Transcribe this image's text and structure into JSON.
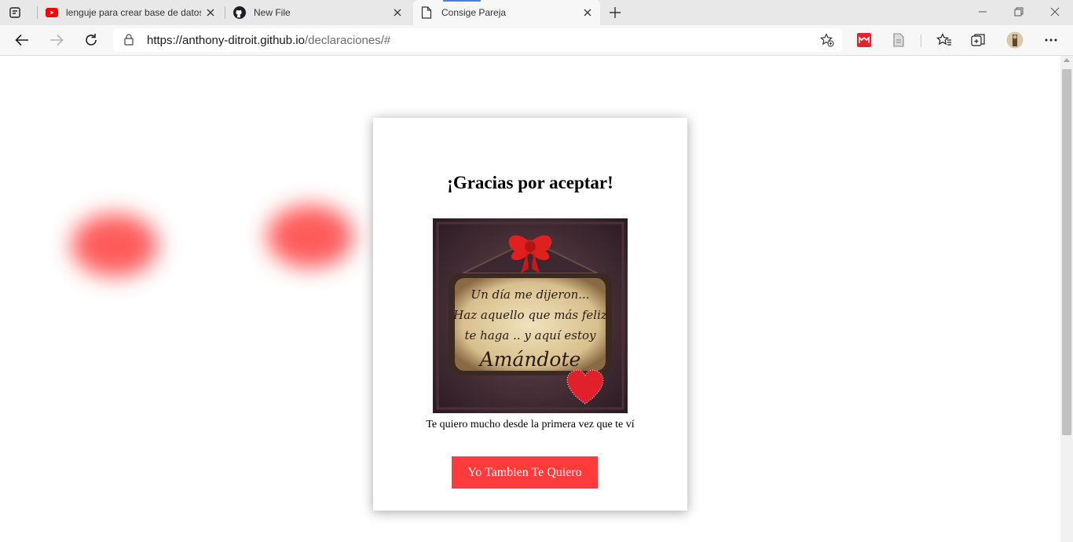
{
  "browser": {
    "tabs": [
      {
        "label": "lenguje para crear base de datos",
        "icon": "youtube-icon"
      },
      {
        "label": "New File",
        "icon": "github-icon"
      },
      {
        "label": "Consige Pareja",
        "icon": "page-icon"
      }
    ],
    "url_host": "https://anthony-ditroit.github.io",
    "url_path": "/declaraciones/#"
  },
  "page": {
    "title": "¡Gracias por aceptar!",
    "image_lines": [
      "Un día me dijeron...",
      "Haz aquello que más feliz",
      "te haga .. y aquí estoy",
      "Amándote"
    ],
    "message": "Te quiero mucho desde la primera vez que te ví",
    "button_label": "Yo Tambien Te Quiero"
  },
  "colors": {
    "accent": "#ff3b3b",
    "blob": "#ff3f3f",
    "active_tab_indicator": "#4a7fd6"
  }
}
